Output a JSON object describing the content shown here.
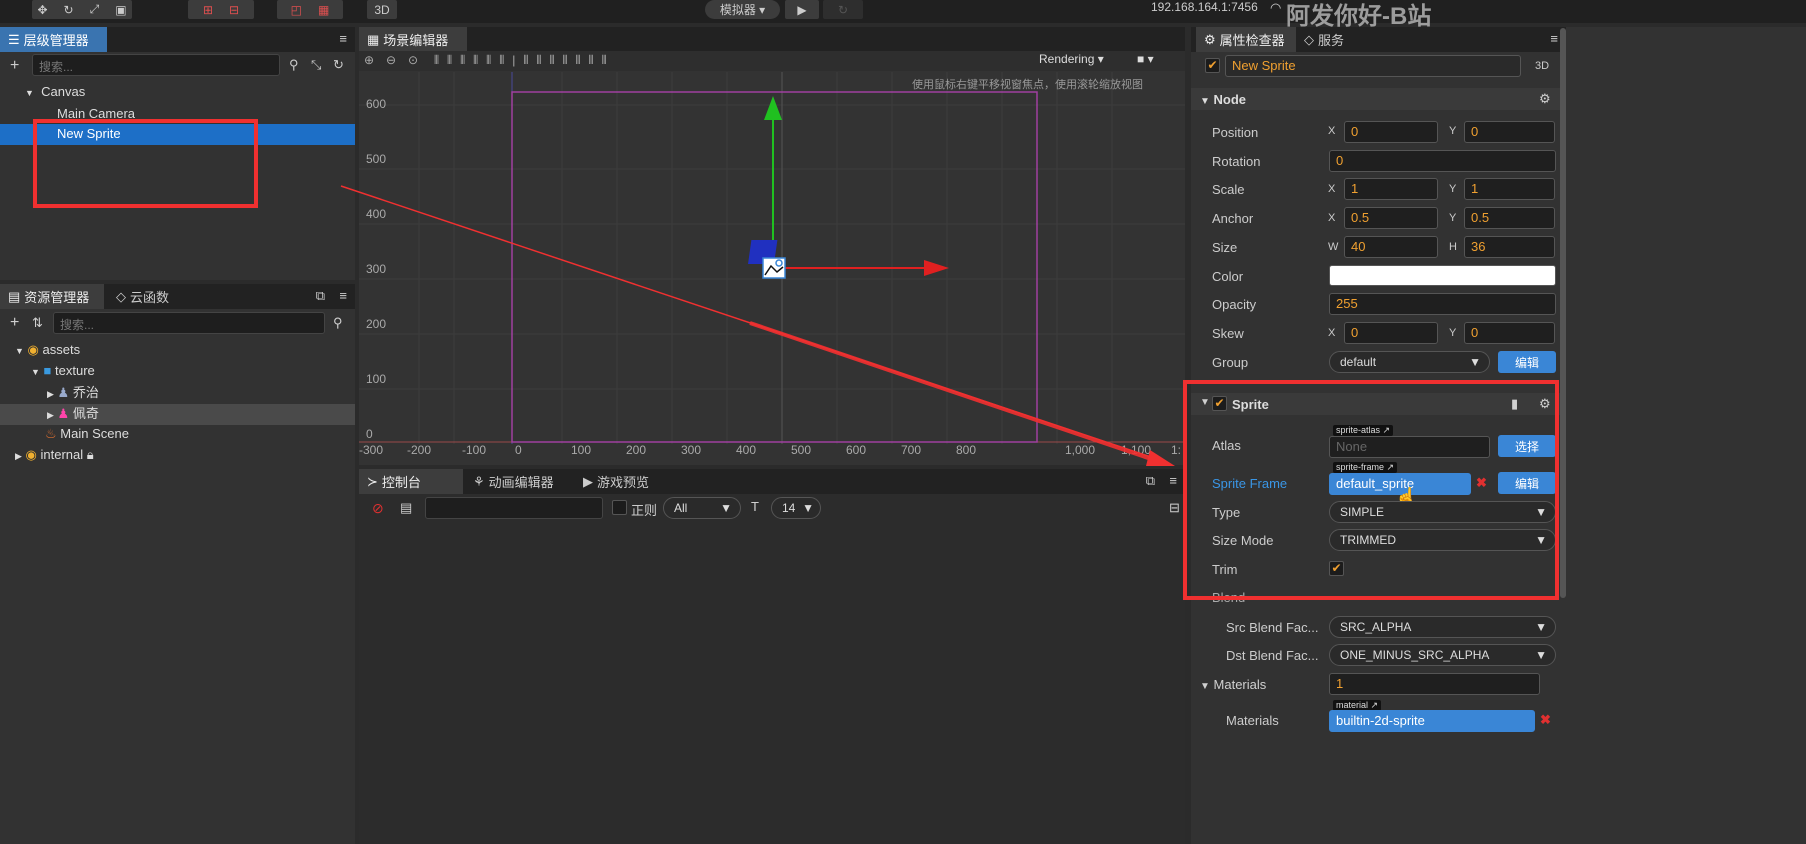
{
  "toolbar": {
    "simulator": "模拟器 ▾",
    "three_d": "3D",
    "ip": "192.168.164.1:7456",
    "overlay": "阿发你好-B站"
  },
  "hierarchy": {
    "tab": "层级管理器",
    "search_placeholder": "搜索...",
    "items": [
      "Canvas",
      "Main Camera",
      "New Sprite"
    ]
  },
  "assets": {
    "tab": "资源管理器",
    "tab2": "云函数",
    "search_placeholder": "搜索...",
    "items": [
      "assets",
      "texture",
      "乔治",
      "佩奇",
      "Main Scene",
      "internal"
    ]
  },
  "scene": {
    "tab": "场景编辑器",
    "rendering": "Rendering",
    "hint": "使用鼠标右键平移视窗焦点，使用滚轮缩放视图",
    "y_ticks": [
      "600",
      "500",
      "400",
      "300",
      "200",
      "100",
      "0"
    ],
    "x_ticks": [
      "-300",
      "-200",
      "-100",
      "0",
      "100",
      "200",
      "300",
      "400",
      "500",
      "600",
      "700",
      "800",
      "900",
      "1,000",
      "1,100",
      "1:"
    ]
  },
  "console": {
    "tab": "控制台",
    "tab2": "动画编辑器",
    "tab3": "游戏预览",
    "regex": "正则",
    "level": "All",
    "font_size": "14"
  },
  "inspector": {
    "tab": "属性检查器",
    "tab2": "服务",
    "node_name": "New Sprite",
    "three_d": "3D",
    "node": {
      "title": "Node",
      "position_label": "Position",
      "pos_x": "0",
      "pos_y": "0",
      "rotation_label": "Rotation",
      "rotation": "0",
      "scale_label": "Scale",
      "scale_x": "1",
      "scale_y": "1",
      "anchor_label": "Anchor",
      "anchor_x": "0.5",
      "anchor_y": "0.5",
      "size_label": "Size",
      "size_w": "40",
      "size_h": "36",
      "color_label": "Color",
      "opacity_label": "Opacity",
      "opacity": "255",
      "skew_label": "Skew",
      "skew_x": "0",
      "skew_y": "0",
      "group_label": "Group",
      "group": "default",
      "edit": "编辑",
      "x": "X",
      "y": "Y",
      "w": "W",
      "h": "H"
    },
    "sprite": {
      "title": "Sprite",
      "atlas_label": "Atlas",
      "atlas_tag": "sprite-atlas",
      "atlas_value": "None",
      "select": "选择",
      "frame_label": "Sprite Frame",
      "frame_tag": "sprite-frame",
      "frame_value": "default_sprite",
      "edit": "编辑",
      "type_label": "Type",
      "type_value": "SIMPLE",
      "sizemode_label": "Size Mode",
      "sizemode_value": "TRIMMED",
      "trim_label": "Trim",
      "blend_label": "Blend",
      "src_label": "Src Blend Fac...",
      "src_value": "SRC_ALPHA",
      "dst_label": "Dst Blend Fac...",
      "dst_value": "ONE_MINUS_SRC_ALPHA"
    },
    "materials": {
      "title": "Materials",
      "count": "1",
      "tag": "material",
      "label": "Materials",
      "value": "builtin-2d-sprite"
    }
  },
  "colors": {
    "accent": "#3a86d6",
    "orange": "#f0a030",
    "annotation_red": "#f03030"
  }
}
